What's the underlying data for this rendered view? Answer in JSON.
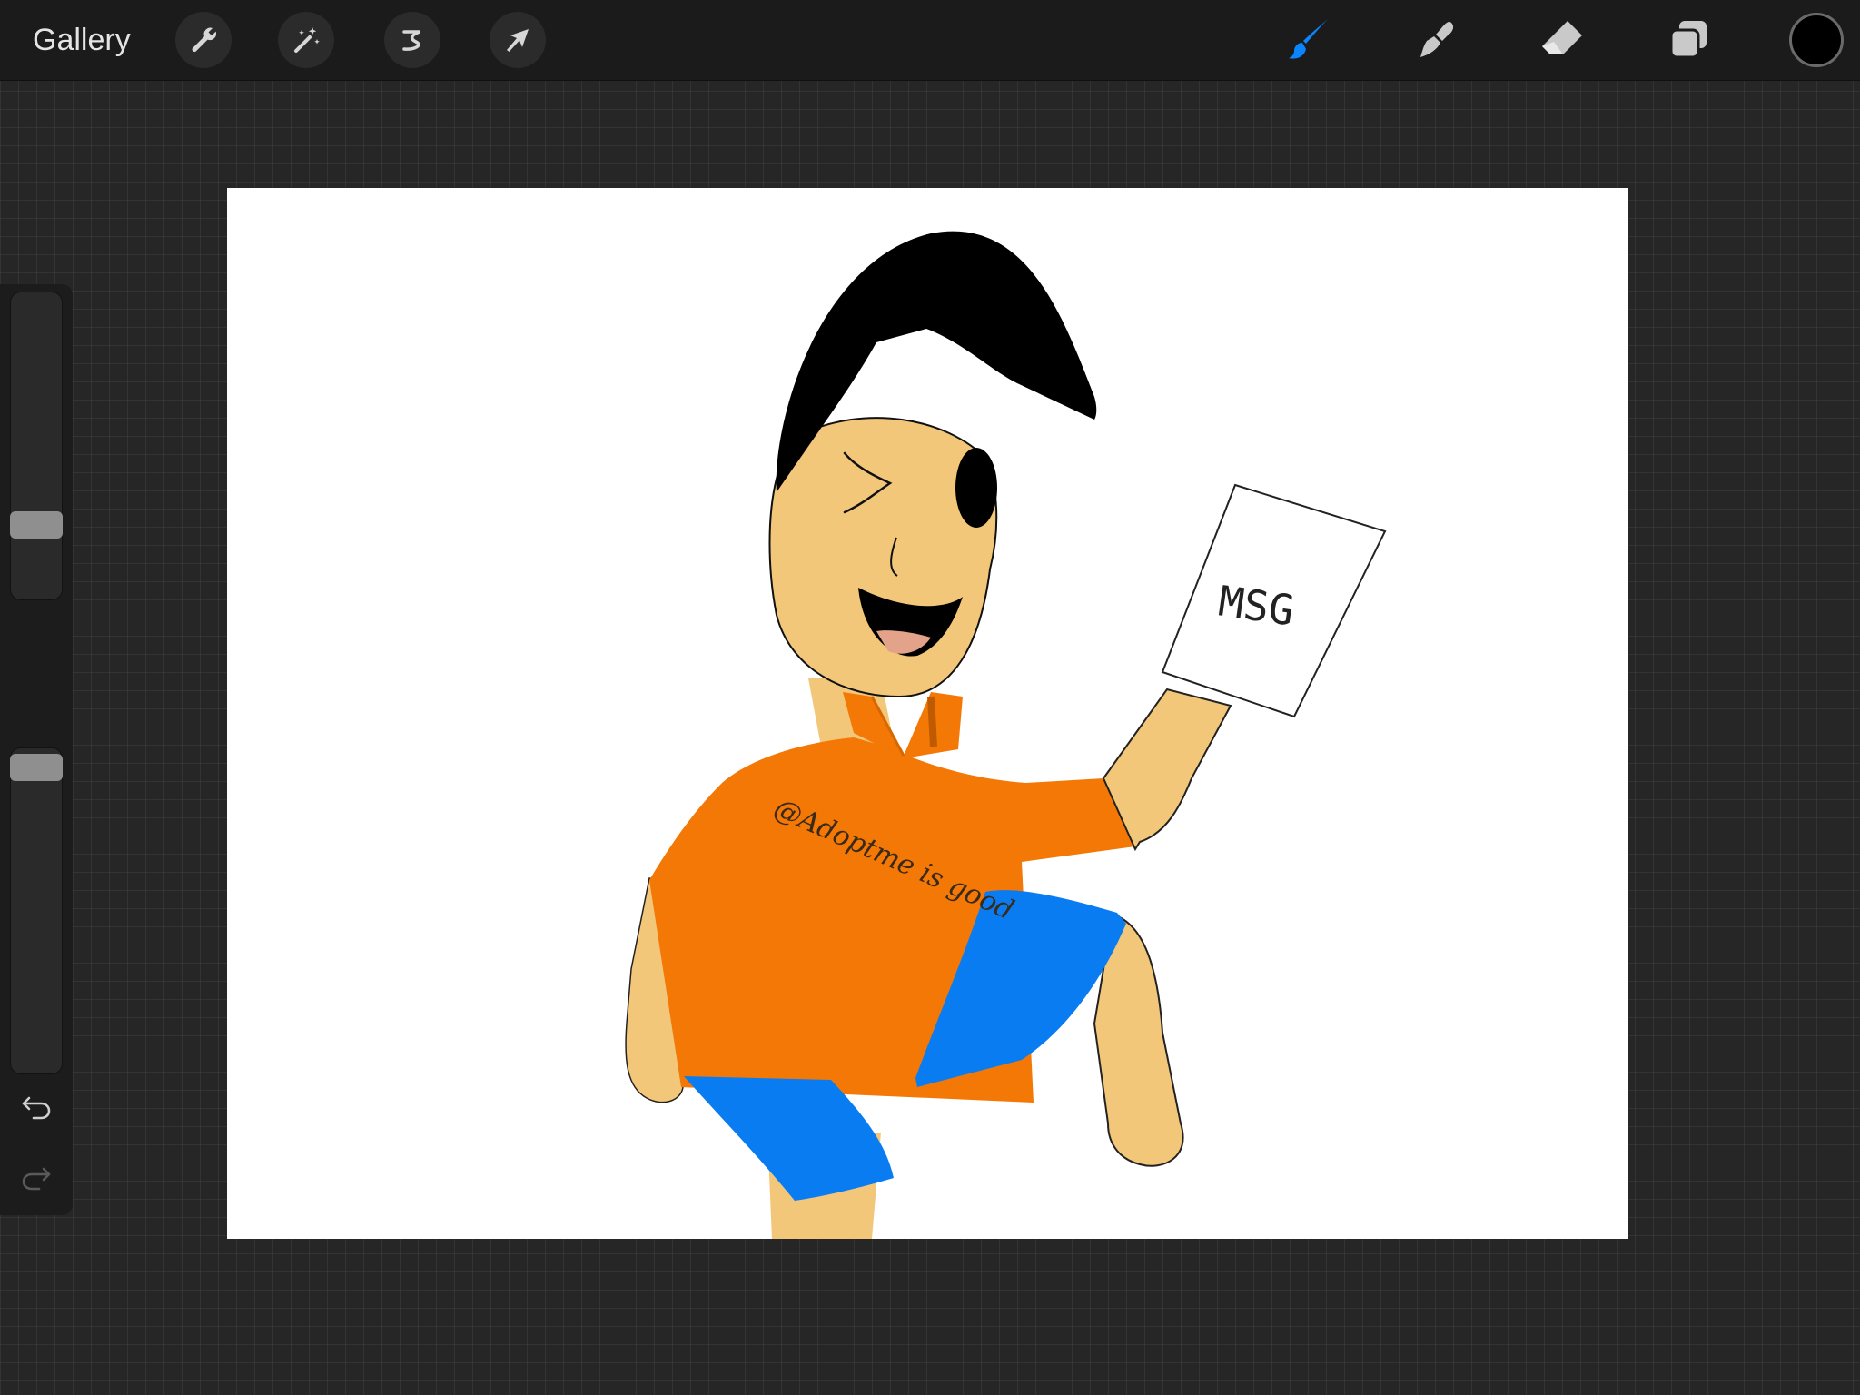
{
  "toolbar": {
    "gallery_label": "Gallery",
    "left_tools": [
      "wrench-icon",
      "magic-wand-icon",
      "selection-icon",
      "transform-arrow-icon"
    ],
    "right_tools": [
      "brush-icon",
      "smudge-icon",
      "eraser-icon",
      "layers-icon"
    ],
    "active_tool": "brush",
    "active_color": "#0a84ff",
    "current_color": "#000000"
  },
  "sidebar": {
    "brush_size_level": 0.22,
    "opacity_level": 0.98,
    "controls": [
      "modify-button",
      "undo-icon",
      "redo-icon"
    ]
  },
  "artwork": {
    "shirt_text": "@Adoptme is good",
    "paper_text": "MSG",
    "colors": {
      "skin": "#f3c77a",
      "hair": "#000000",
      "shirt": "#f37805",
      "shorts": "#0a7cf2",
      "mouth": "#e3a28a"
    }
  }
}
